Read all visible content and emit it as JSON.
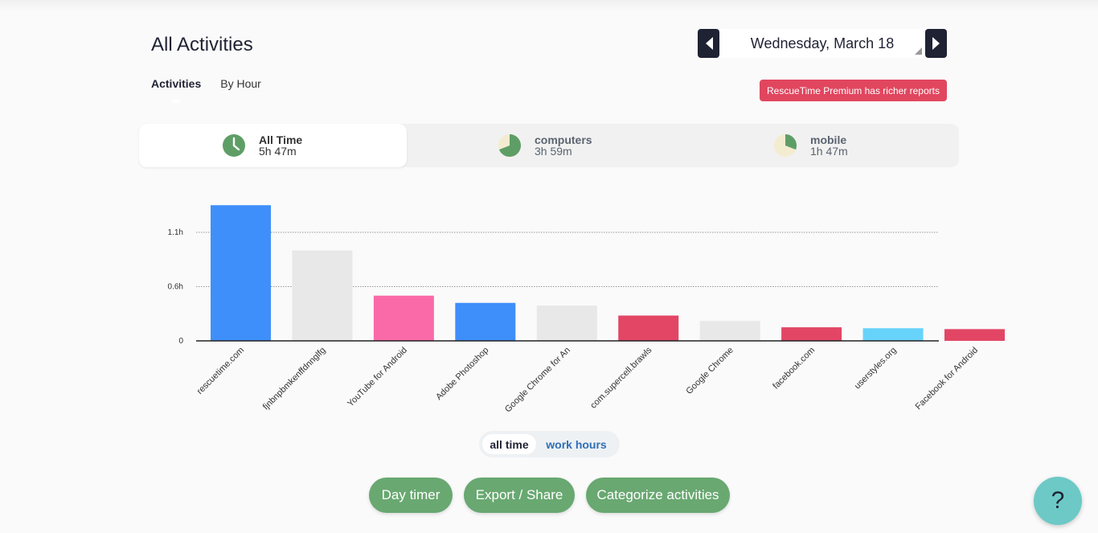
{
  "page": {
    "title": "All Activities"
  },
  "tabs": [
    {
      "label": "Activities",
      "active": true
    },
    {
      "label": "By Hour",
      "active": false
    }
  ],
  "date_nav": {
    "date": "Wednesday, March 18",
    "prev_icon": "chevron-left-icon",
    "next_icon": "chevron-right-icon"
  },
  "premium_badge": {
    "text": "RescueTime Premium has richer reports",
    "color": "#e1465f"
  },
  "segments": [
    {
      "label": "All Time",
      "value": "5h 47m",
      "icon": "clock-icon",
      "active": true,
      "fraction": 1.0
    },
    {
      "label": "computers",
      "value": "3h 59m",
      "icon": "pie-icon",
      "active": false,
      "fraction": 0.69
    },
    {
      "label": "mobile",
      "value": "1h 47m",
      "icon": "pie-icon",
      "active": false,
      "fraction": 0.31
    }
  ],
  "chart_data": {
    "type": "bar",
    "categories": [
      "rescuetime.com",
      "fjnbnpbmkenffdnnglfg",
      "YouTube for Android",
      "Adobe Photoshop",
      "Google Chrome for An",
      "com.supercell.brawls",
      "Google Chrome",
      "facebook.com",
      "userstyles.org",
      "Facebook for Android"
    ],
    "values": [
      1.5,
      1.0,
      0.5,
      0.42,
      0.39,
      0.28,
      0.22,
      0.15,
      0.14,
      0.13
    ],
    "colors": [
      "#3f8ffa",
      "#e8e8e8",
      "#fb6aa8",
      "#3f8ffa",
      "#e8e8e8",
      "#e24664",
      "#e8e8e8",
      "#e24664",
      "#67d3fa",
      "#e24664"
    ],
    "yticks": [
      {
        "value": 0,
        "label": "0"
      },
      {
        "value": 0.6,
        "label": "0.6h"
      },
      {
        "value": 1.2,
        "label": "1.1h"
      }
    ],
    "ylim": [
      0,
      1.6
    ],
    "grid": true
  },
  "time_toggle": {
    "options": [
      "all time",
      "work hours"
    ],
    "selected": "all time"
  },
  "actions": [
    "Day timer",
    "Export / Share",
    "Categorize activities"
  ],
  "help": {
    "label": "?"
  },
  "colors": {
    "green": "#69a871",
    "dark": "#1f2233",
    "accent_blue": "#2f6fb8",
    "help": "#6cc9c6"
  }
}
